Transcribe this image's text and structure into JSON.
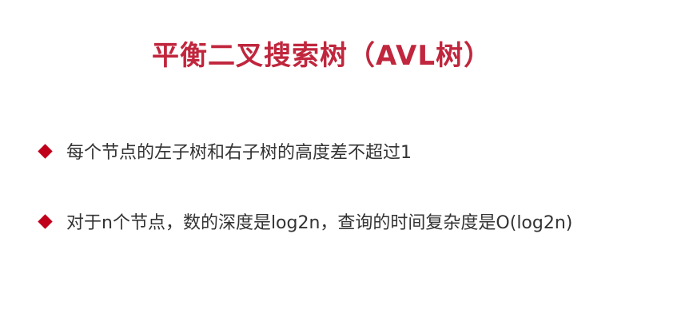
{
  "slide": {
    "title": "平衡二叉搜索树（AVL树）",
    "title_color": "#c0263d",
    "bullet_icon": "diamond-icon",
    "bullet_color": "#c0001a",
    "bullets": [
      "每个节点的左子树和右子树的高度差不超过1",
      "对于n个节点，数的深度是log2n，查询的时间复杂度是O(log2n)"
    ]
  }
}
